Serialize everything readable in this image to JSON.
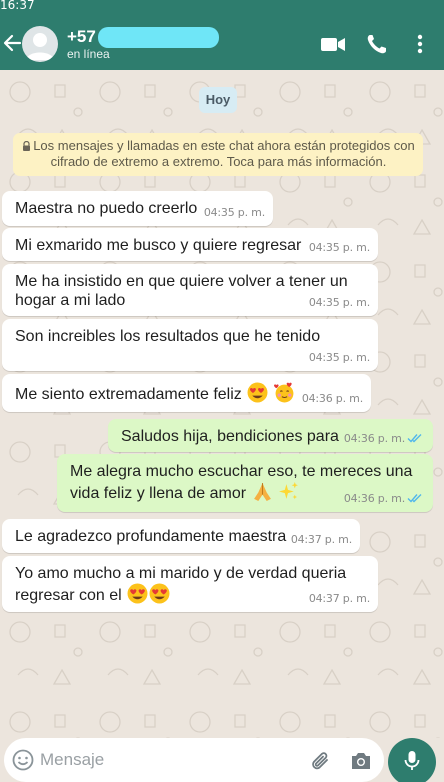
{
  "status_bar": {
    "time": "16:37"
  },
  "header": {
    "contact_name": "+57",
    "contact_status": "en línea"
  },
  "chat": {
    "day_label": "Hoy",
    "encryption_notice": "Los mensajes y llamadas en este chat ahora están protegidos con cifrado de extremo a extremo. Toca para más información.",
    "messages": [
      {
        "direction": "in",
        "text": "Maestra no puedo creerlo",
        "time": "04:35 p. m."
      },
      {
        "direction": "in",
        "text": "Mi exmarido me busco y quiere regresar",
        "time": "04:35 p. m."
      },
      {
        "direction": "in",
        "text": "Me ha insistido en que quiere volver a tener un hogar a mi lado",
        "time": "04:35 p. m."
      },
      {
        "direction": "in",
        "text": "Son increibles los resultados que he tenido",
        "time": "04:35 p. m."
      },
      {
        "direction": "in",
        "text": "Me siento extremadamente feliz",
        "time": "04:36 p. m.",
        "emojis": [
          "heart-eyes-emoji",
          "hearts-face-emoji"
        ]
      },
      {
        "direction": "out",
        "text": "Saludos hija, bendiciones para ti",
        "time": "04:36 p. m.",
        "read": true
      },
      {
        "direction": "out",
        "text": "Me alegra mucho escuchar eso, te mereces una vida feliz y llena de amor",
        "time": "04:36 p. m.",
        "read": true,
        "emojis": [
          "folded-hands-emoji",
          "sparkles-emoji"
        ]
      },
      {
        "direction": "in",
        "text": "Le agradezco profundamente maestra",
        "time": "04:37 p. m."
      },
      {
        "direction": "in",
        "text": "Yo amo mucho a mi marido y de verdad queria regresar con el",
        "time": "04:37 p. m.",
        "emojis": [
          "heart-eyes-emoji",
          "heart-eyes-emoji"
        ]
      }
    ]
  },
  "composer": {
    "placeholder": "Mensaje"
  },
  "colors": {
    "header": "#2e7d6e",
    "chat_background": "#ece5dd",
    "incoming_bubble": "#ffffff",
    "outgoing_bubble": "#dcf8c6",
    "read_ticks": "#4fb6ec",
    "notice_background": "#fdf2c4"
  }
}
